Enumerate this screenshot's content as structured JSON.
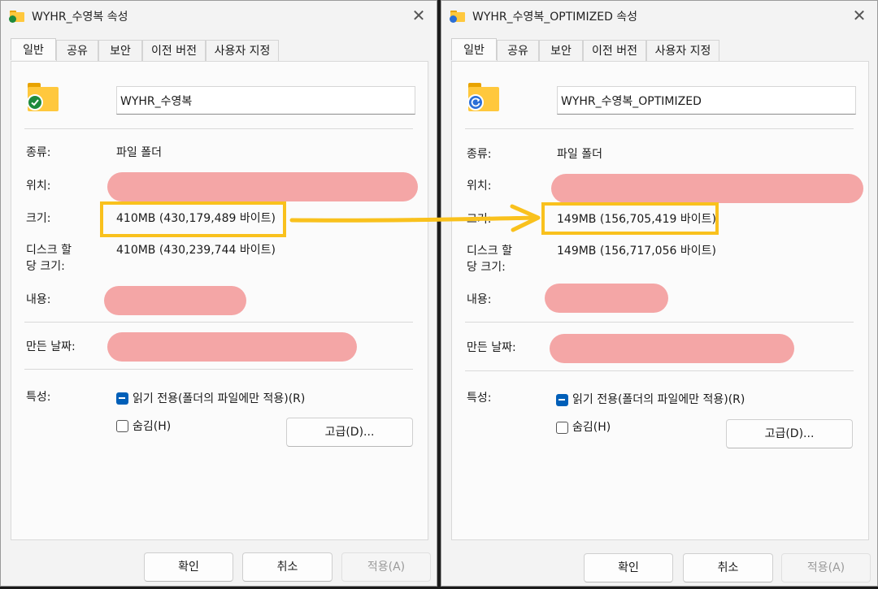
{
  "colors": {
    "accent": "#005fb8",
    "highlight": "#f9c11d",
    "redaction": "#f4a6a6",
    "folder": "#ffc83d"
  },
  "windows": [
    {
      "title": "WYHR_수영복 속성",
      "badge_icon": "green-check-badge-icon",
      "tabs": [
        "일반",
        "공유",
        "보안",
        "이전 버전",
        "사용자 지정"
      ],
      "name_value": "WYHR_수영복",
      "labels": {
        "type": "종류:",
        "location": "위치:",
        "size": "크기:",
        "disk_size_line1": "디스크 할",
        "disk_size_line2": "당 크기:",
        "contents": "내용:",
        "created": "만든 날짜:",
        "attributes": "특성:"
      },
      "values": {
        "type": "파일 폴더",
        "size": "410MB (430,179,489 바이트)",
        "disk_size": "410MB (430,239,744 바이트)"
      },
      "attributes": {
        "readonly": "읽기 전용(폴더의 파일에만 적용)(R)",
        "hidden": "숨김(H)",
        "advanced_button": "고급(D)..."
      },
      "buttons": {
        "ok": "확인",
        "cancel": "취소",
        "apply": "적용(A)"
      }
    },
    {
      "title": "WYHR_수영복_OPTIMIZED 속성",
      "badge_icon": "blue-sync-badge-icon",
      "tabs": [
        "일반",
        "공유",
        "보안",
        "이전 버전",
        "사용자 지정"
      ],
      "name_value": "WYHR_수영복_OPTIMIZED",
      "labels": {
        "type": "종류:",
        "location": "위치:",
        "size": "크기:",
        "disk_size_line1": "디스크 할",
        "disk_size_line2": "당 크기:",
        "contents": "내용:",
        "created": "만든 날짜:",
        "attributes": "특성:"
      },
      "values": {
        "type": "파일 폴더",
        "size": "149MB (156,705,419 바이트)",
        "disk_size": "149MB (156,717,056 바이트)"
      },
      "attributes": {
        "readonly": "읽기 전용(폴더의 파일에만 적용)(R)",
        "hidden": "숨김(H)",
        "advanced_button": "고급(D)..."
      },
      "buttons": {
        "ok": "확인",
        "cancel": "취소",
        "apply": "적용(A)"
      }
    }
  ]
}
